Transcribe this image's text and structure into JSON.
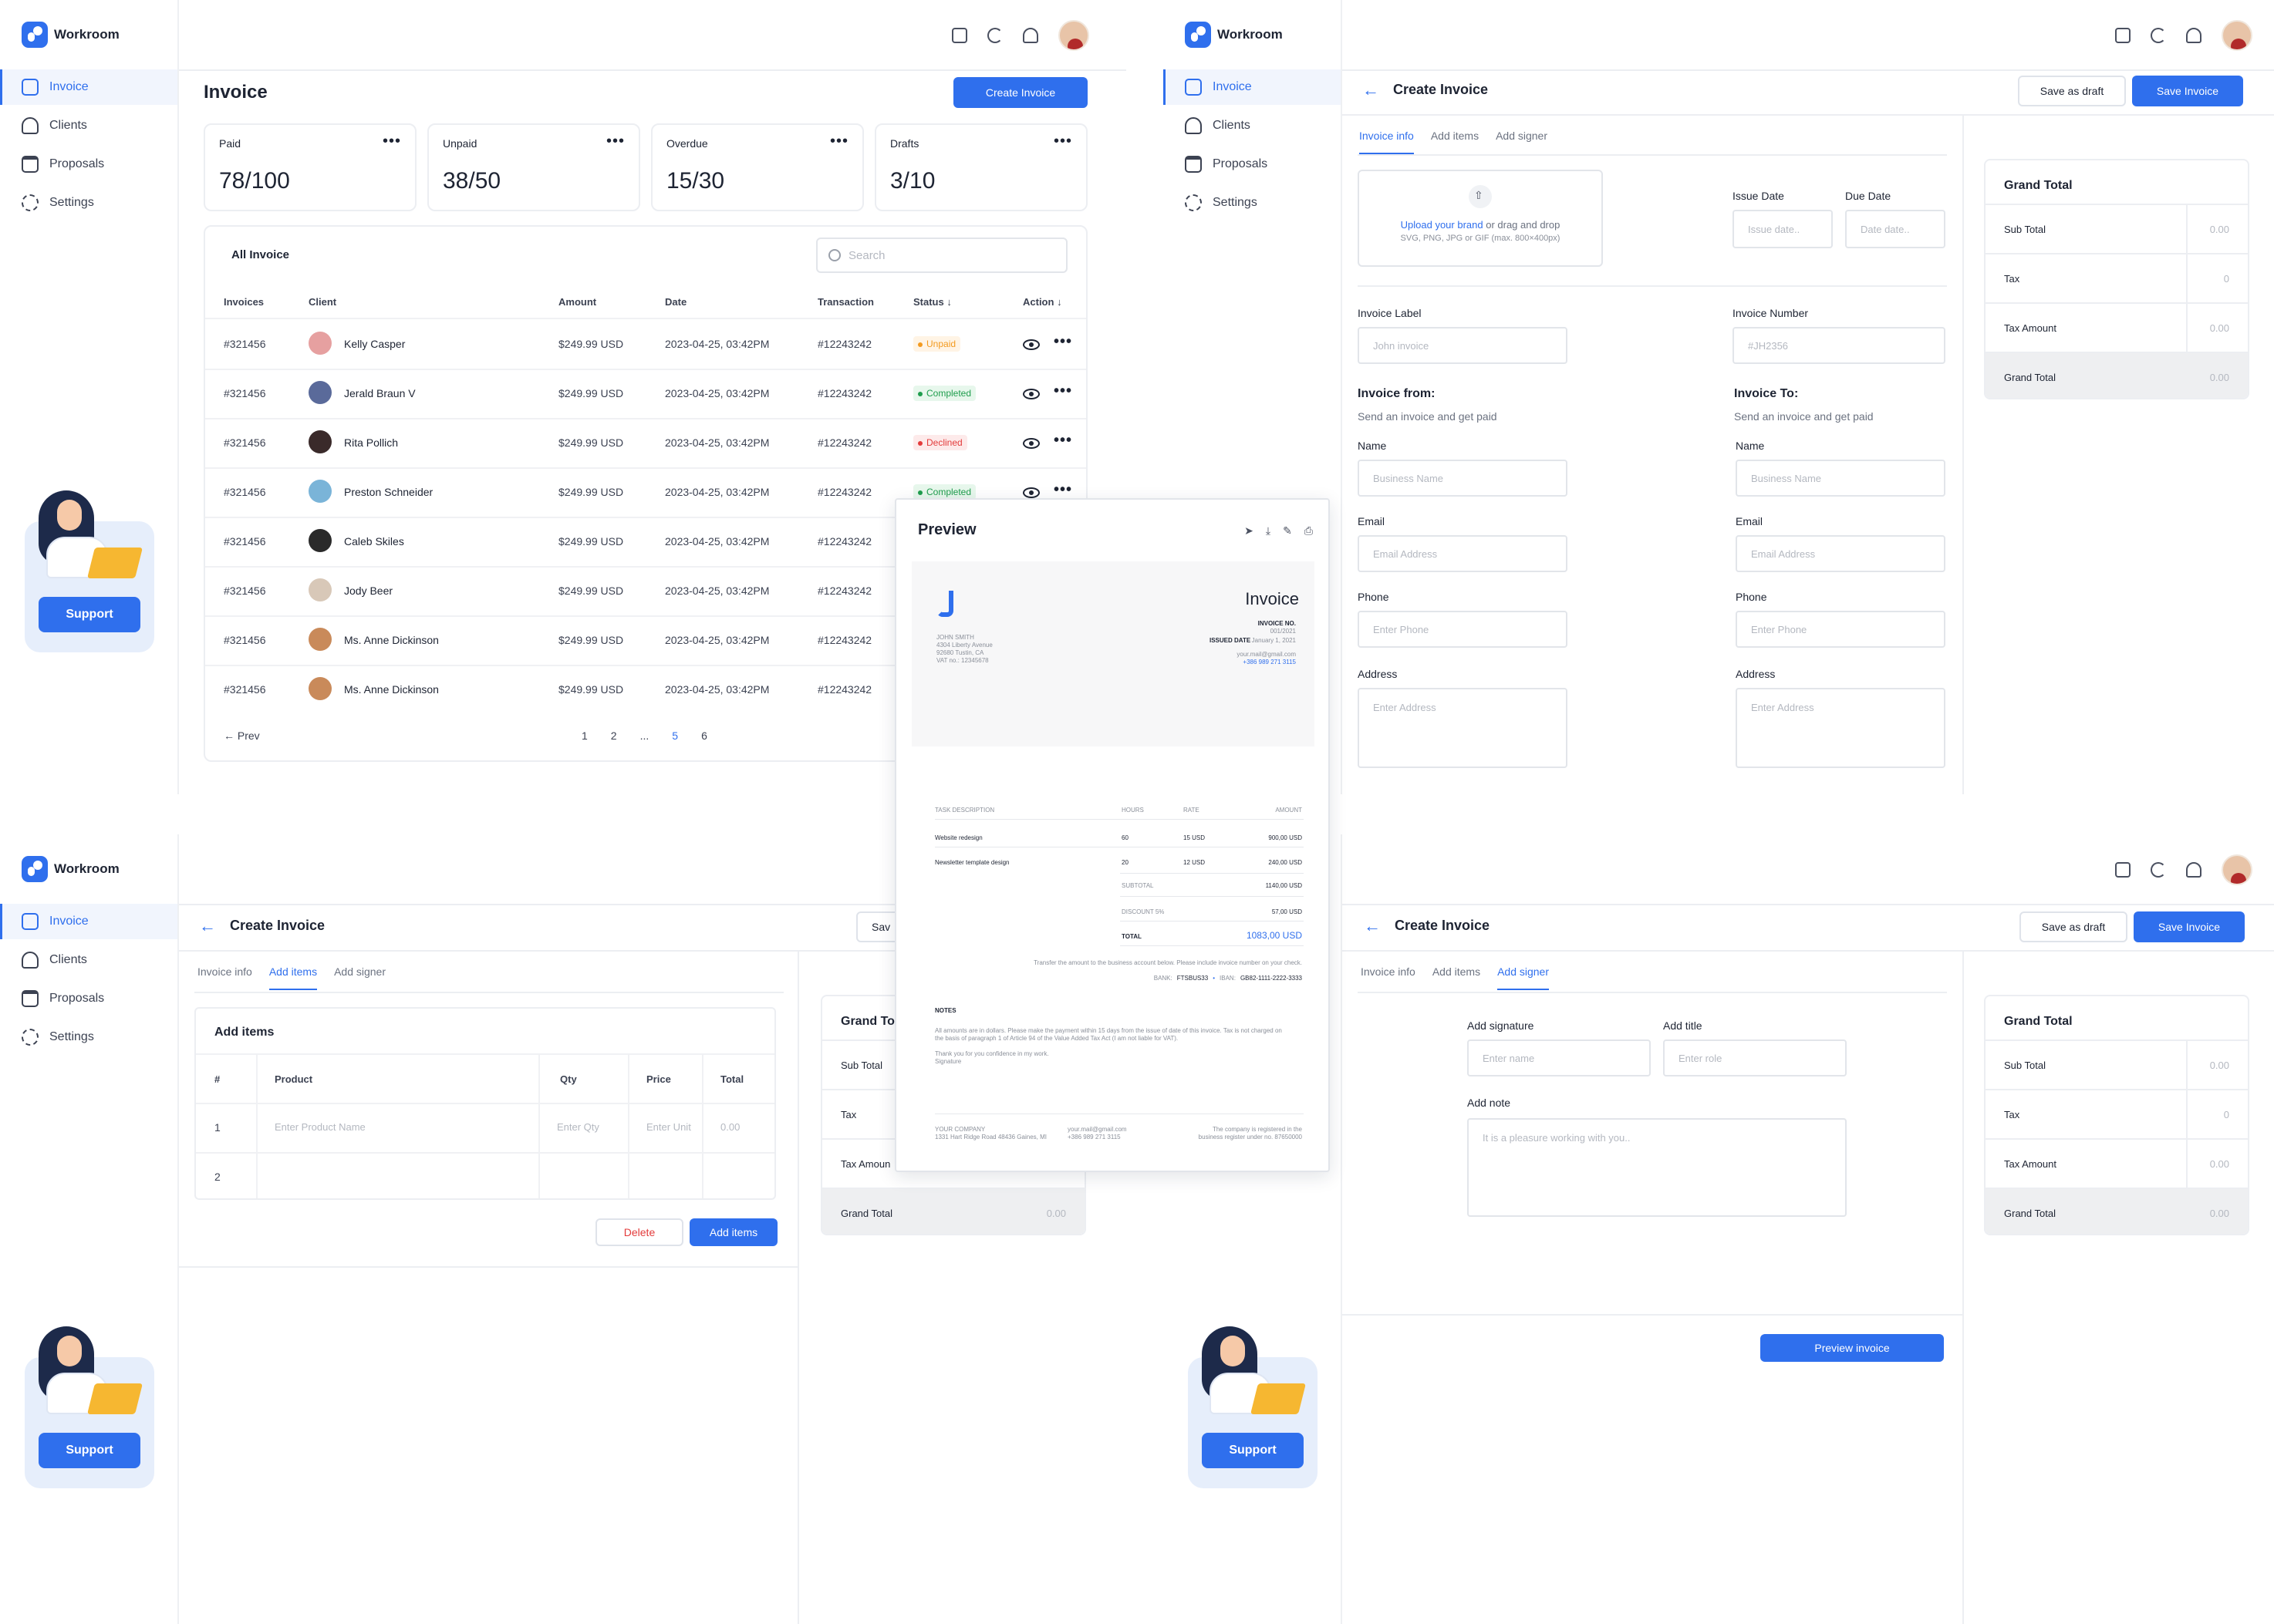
{
  "app": {
    "name": "Workroom",
    "nav": [
      "Invoice",
      "Clients",
      "Proposals",
      "Settings"
    ],
    "support": "Support"
  },
  "list": {
    "title": "Invoice",
    "create_btn": "Create Invoice",
    "stats": [
      {
        "label": "Paid",
        "value": "78/100"
      },
      {
        "label": "Unpaid",
        "value": "38/50"
      },
      {
        "label": "Overdue",
        "value": "15/30"
      },
      {
        "label": "Drafts",
        "value": "3/10"
      }
    ],
    "table_title": "All Invoice",
    "search_placeholder": "Search",
    "columns": [
      "Invoices",
      "Client",
      "Amount",
      "Date",
      "Transaction",
      "Status",
      "Action"
    ],
    "rows": [
      {
        "id": "#321456",
        "client": "Kelly Casper",
        "amount": "$249.99 USD",
        "date": "2023-04-25, 03:42PM",
        "txn": "#12243242",
        "status": "Unpaid",
        "kind": "unpaid",
        "av": "#e6a0a0"
      },
      {
        "id": "#321456",
        "client": "Jerald Braun V",
        "amount": "$249.99 USD",
        "date": "2023-04-25, 03:42PM",
        "txn": "#12243242",
        "status": "Completed",
        "kind": "completed",
        "av": "#5a6a9a"
      },
      {
        "id": "#321456",
        "client": "Rita Pollich",
        "amount": "$249.99 USD",
        "date": "2023-04-25, 03:42PM",
        "txn": "#12243242",
        "status": "Declined",
        "kind": "declined",
        "av": "#3a2a2a"
      },
      {
        "id": "#321456",
        "client": "Preston Schneider",
        "amount": "$249.99 USD",
        "date": "2023-04-25, 03:42PM",
        "txn": "#12243242",
        "status": "Completed",
        "kind": "completed",
        "av": "#7ab4d8"
      },
      {
        "id": "#321456",
        "client": "Caleb Skiles",
        "amount": "$249.99 USD",
        "date": "2023-04-25, 03:42PM",
        "txn": "#12243242",
        "status": "",
        "kind": "",
        "av": "#2a2a2a"
      },
      {
        "id": "#321456",
        "client": "Jody Beer",
        "amount": "$249.99 USD",
        "date": "2023-04-25, 03:42PM",
        "txn": "#12243242",
        "status": "",
        "kind": "",
        "av": "#d8c8b8"
      },
      {
        "id": "#321456",
        "client": "Ms. Anne Dickinson",
        "amount": "$249.99 USD",
        "date": "2023-04-25, 03:42PM",
        "txn": "#12243242",
        "status": "",
        "kind": "",
        "av": "#c98a5a"
      },
      {
        "id": "#321456",
        "client": "Ms. Anne Dickinson",
        "amount": "$249.99 USD",
        "date": "2023-04-25, 03:42PM",
        "txn": "#12243242",
        "status": "",
        "kind": "",
        "av": "#c98a5a"
      }
    ],
    "prev": "Prev",
    "pages": [
      "1",
      "2",
      "...",
      "5",
      "6"
    ],
    "active_page": "5"
  },
  "create": {
    "title": "Create Invoice",
    "save_draft": "Save as draft",
    "save": "Save Invoice",
    "tabs": [
      "Invoice info",
      "Add items",
      "Add signer"
    ],
    "upload_link": "Upload your brand",
    "upload_text": " or drag and drop",
    "upload_hint": "SVG, PNG, JPG or GIF (max. 800×400px)",
    "issue_date": "Issue Date",
    "issue_ph": "Issue date..",
    "due_date": "Due Date",
    "due_ph": "Date date..",
    "invoice_label": "Invoice Label",
    "invoice_label_ph": "John invoice",
    "invoice_number": "Invoice Number",
    "invoice_number_ph": "#JH2356",
    "from_title": "Invoice from:",
    "from_sub": "Send an invoice and get paid",
    "to_title": "Invoice To:",
    "to_sub": "Send an invoice and get paid",
    "name": "Name",
    "name_ph": "Business Name",
    "email": "Email",
    "email_ph": "Email Address",
    "phone": "Phone",
    "phone_ph": "Enter Phone",
    "address": "Address",
    "address_ph": "Enter Address"
  },
  "grand": {
    "title": "Grand Total",
    "rows": [
      {
        "k": "Sub Total",
        "v": "0.00"
      },
      {
        "k": "Tax",
        "v": "0"
      },
      {
        "k": "Tax Amount",
        "v": "0.00"
      }
    ],
    "total_k": "Grand Total",
    "total_v": "0.00",
    "title_cut": "Grand To",
    "tax_amount_cut": "Tax Amoun"
  },
  "items": {
    "title": "Add items",
    "cols": [
      "#",
      "Product",
      "Qty",
      "Price",
      "Total"
    ],
    "row1": {
      "n": "1",
      "product_ph": "Enter Product Name",
      "qty_ph": "Enter Qty",
      "price_ph": "Enter Unit",
      "total": "0.00"
    },
    "row2": {
      "n": "2"
    },
    "delete": "Delete",
    "add": "Add items",
    "save_cut": "Sav"
  },
  "signer": {
    "sig_label": "Add signature",
    "sig_ph": "Enter name",
    "title_label": "Add title",
    "title_ph": "Enter role",
    "note_label": "Add note",
    "note_ph": "It is a pleasure working with you..",
    "preview_btn": "Preview invoice"
  },
  "preview": {
    "title": "Preview",
    "doc_title": "Invoice",
    "from_lines": [
      "JOHN SMITH",
      "4304 Liberty Avenue",
      "92680 Tustin, CA",
      "VAT no.: 12345678"
    ],
    "invno_label": "INVOICE NO.",
    "invno": "001/2021",
    "issued_label": "ISSUED DATE",
    "issued": "January 1, 2021",
    "email": "your.mail@gmail.com",
    "phone": "+386 989 271 3115",
    "cols": [
      "TASK DESCRIPTION",
      "HOURS",
      "RATE",
      "AMOUNT"
    ],
    "lines": [
      {
        "d": "Website redesign",
        "h": "60",
        "r": "15 USD",
        "a": "900,00 USD"
      },
      {
        "d": "Newsletter template design",
        "h": "20",
        "r": "12 USD",
        "a": "240,00 USD"
      }
    ],
    "subtotal_label": "SUBTOTAL",
    "subtotal": "1140,00 USD",
    "discount_label": "DISCOUNT 5%",
    "discount": "57,00 USD",
    "total_label": "TOTAL",
    "total": "1083,00 USD",
    "transfer": "Transfer the amount to the business account below. Please include invoice number on your check.",
    "bank_label": "BANK:",
    "bank": "FTSBUS33",
    "iban_label": "IBAN:",
    "iban": "GB82-1111-2222-3333",
    "notes_label": "NOTES",
    "notes1": "All amounts are in dollars. Please make the payment within 15 days from the issue of date of this invoice. Tax is not charged on",
    "notes2": "the basis of paragraph 1 of Article 94 of the Value Added Tax Act (I am not liable for VAT).",
    "thanks": "Thank you for you confidence in my work.",
    "signature": "Signature",
    "footer_l1": "YOUR COMPANY",
    "footer_l2": "1331 Hart Ridge Road 48436 Gaines, MI",
    "footer_m1": "your.mail@gmail.com",
    "footer_m2": "+386 989 271 3115",
    "footer_r1": "The company is registered in the",
    "footer_r2": "business register under no. 87650000"
  },
  "colors": {
    "accent": "#2f6fed",
    "unpaid": "#f39a1f",
    "completed": "#1f9d4d",
    "declined": "#e33b3b"
  }
}
